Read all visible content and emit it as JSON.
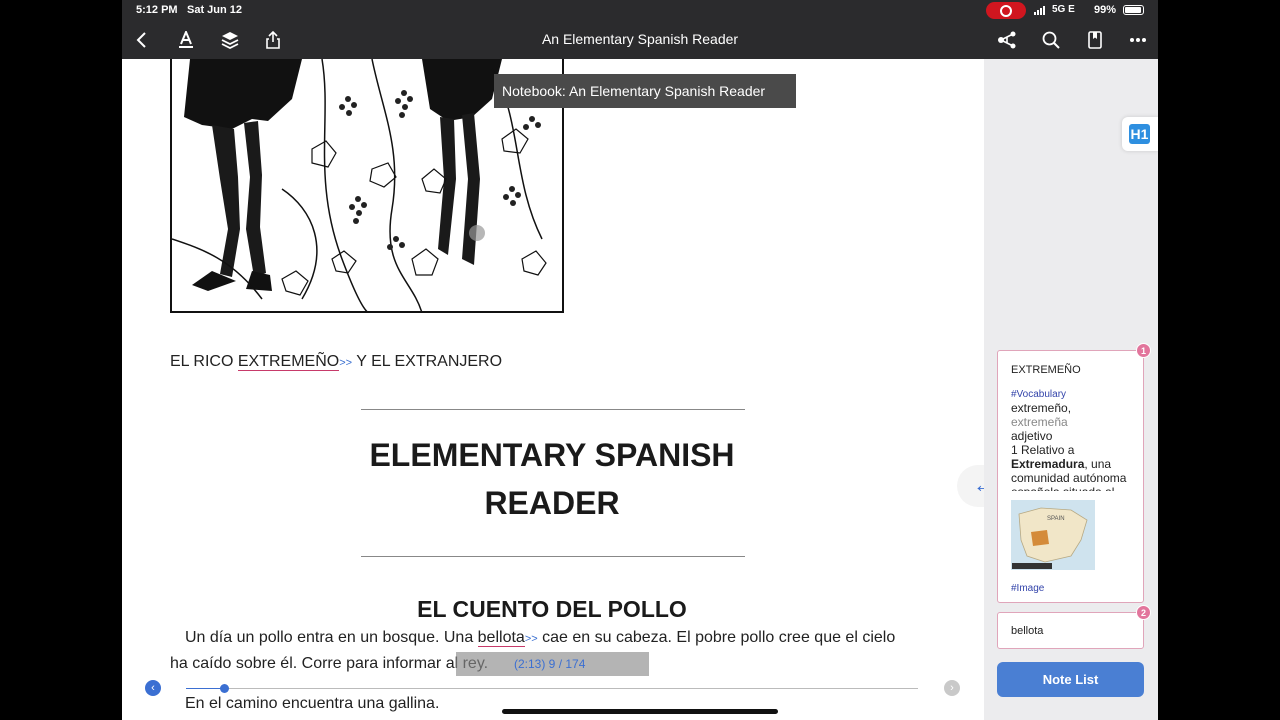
{
  "status_bar": {
    "time": "5:12 PM",
    "date": "Sat Jun 12",
    "network": "5G E",
    "battery": "99%"
  },
  "toolbar": {
    "title": "An Elementary Spanish Reader",
    "icons": [
      "chevron-left-icon",
      "text-format-icon",
      "layers-icon",
      "share-icon",
      "connections-icon",
      "search-icon",
      "bookmark-icon",
      "more-icon"
    ]
  },
  "reader": {
    "tooltip": "Notebook: An Elementary Spanish Reader",
    "chapter_heading_pre": "EL RICO ",
    "chapter_heading_link": "EXTREMEÑO",
    "chapter_heading_post": " Y EL EXTRANJERO",
    "link_marker": ">>",
    "main_title_line1": "ELEMENTARY SPANISH",
    "main_title_line2": "READER",
    "story_title": "EL CUENTO DEL POLLO",
    "para1_a": "Un día un pollo entra en un bosque. Una ",
    "para1_link": "bellota",
    "para1_b": " cae en su cabeza. El pobre pollo cree que el cielo",
    "para2_a": "ha caído sobre él. Corre para informar ",
    "para2_b": "al rey.",
    "para3": "En el camino encuentra una gallina.",
    "page_info": "(2:13)  9 / 174",
    "progress": {
      "current_page": 9,
      "total_pages": 174
    }
  },
  "notebook": {
    "h1_label": "H1",
    "note1": {
      "badge": "1",
      "title": "EXTREMEÑO",
      "tag1": "#Vocabulary",
      "word": "extremeño",
      "word_alt": "extremeña",
      "pos": "adjetivo",
      "def_a": "1 Relativo a ",
      "def_bold": "Extremadura",
      "def_b": ", una comunidad autónoma española situada al",
      "map_label": "SPAIN",
      "tag2": "#Image"
    },
    "note2": {
      "badge": "2",
      "text": "bellota"
    },
    "note_list_label": "Note List"
  }
}
